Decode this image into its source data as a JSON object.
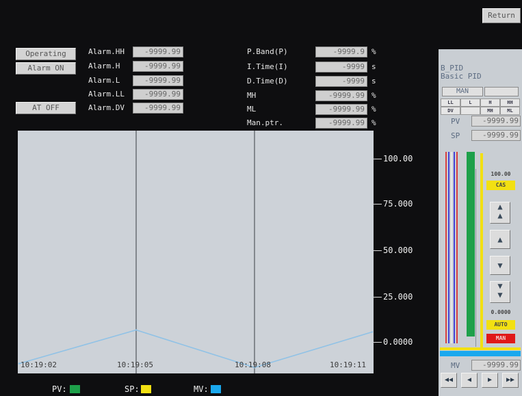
{
  "top": {
    "return_label": "Return"
  },
  "left_buttons": {
    "operating": "Operating",
    "alarm_on": "Alarm ON",
    "at_off": "AT OFF"
  },
  "alarms": [
    {
      "label": "Alarm.HH",
      "value": "-9999.99"
    },
    {
      "label": "Alarm.H",
      "value": "-9999.99"
    },
    {
      "label": "Alarm.L",
      "value": "-9999.99"
    },
    {
      "label": "Alarm.LL",
      "value": "-9999.99"
    },
    {
      "label": "Alarm.DV",
      "value": "-9999.99"
    }
  ],
  "params": [
    {
      "label": "P.Band(P)",
      "value": "-9999.9",
      "unit": "%"
    },
    {
      "label": "I.Time(I)",
      "value": "-9999",
      "unit": "s"
    },
    {
      "label": "D.Time(D)",
      "value": "-9999",
      "unit": "s"
    },
    {
      "label": "MH",
      "value": "-9999.99",
      "unit": "%"
    },
    {
      "label": "ML",
      "value": "-9999.99",
      "unit": "%"
    },
    {
      "label": "Man.ptr.",
      "value": "-9999.99",
      "unit": "%"
    }
  ],
  "chart_data": {
    "type": "line",
    "x": [
      "10:19:02",
      "10:19:05",
      "10:19:08",
      "10:19:11"
    ],
    "y_ticks": [
      "100.00",
      "75.000",
      "50.000",
      "25.000",
      "0.0000"
    ],
    "ylim": [
      -10,
      113
    ],
    "series": [
      {
        "name": "SP",
        "color": "#90c2e6",
        "values": [
          -5.0,
          12.0,
          -7.0,
          11.0
        ]
      }
    ],
    "legend": [
      {
        "name": "PV:",
        "color": "#1ea04a"
      },
      {
        "name": "SP:",
        "color": "#f2e012"
      },
      {
        "name": "MV:",
        "color": "#1aa8ee"
      }
    ]
  },
  "panel": {
    "tag": "B_PID",
    "description": "Basic PID",
    "mode": "MAN",
    "alarm_grid": [
      "LL",
      "L",
      "H",
      "HH",
      "DV",
      "",
      "MH",
      "ML"
    ],
    "pv_label": "PV",
    "pv_value": "-9999.99",
    "sp_label": "SP",
    "sp_value": "-9999.99",
    "bar_high": "100.00",
    "cas_label": "CAS",
    "bar_low": "0.0000",
    "auto_label": "AUTO",
    "man_label": "MAN",
    "mv_label": "MV",
    "mv_value": "-9999.99"
  },
  "colors": {
    "man_red": "#e01818",
    "badge_yellow": "#f2e012",
    "pv_bar": "#1ea04a",
    "mv_bar": "#1aa8ee"
  }
}
